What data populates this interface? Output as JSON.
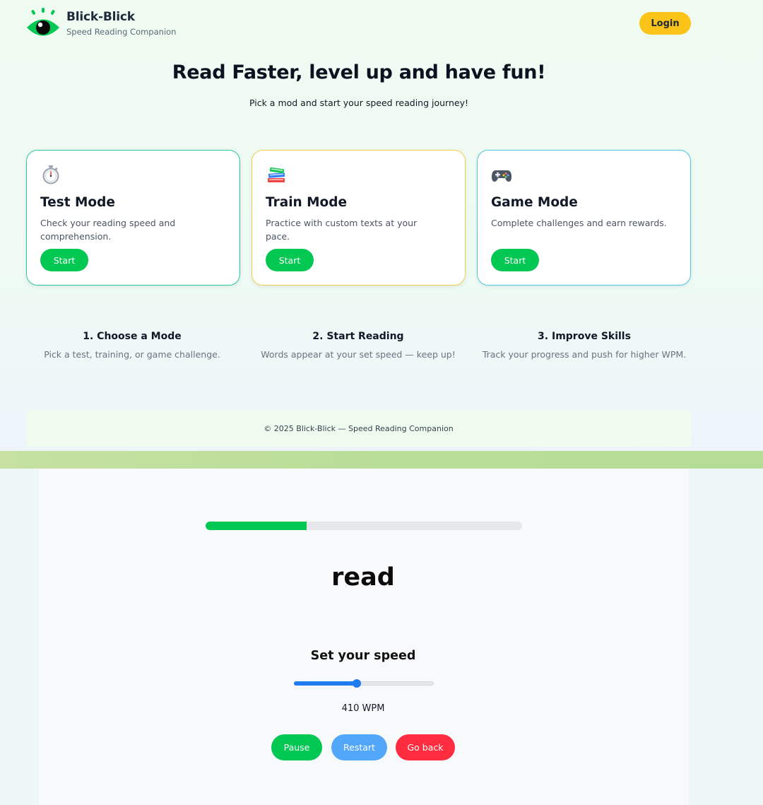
{
  "header": {
    "brand_name": "Blick-Blick",
    "brand_tagline": "Speed Reading Companion",
    "login_label": "Login"
  },
  "hero": {
    "title": "Read Faster, level up and have fun!",
    "subtitle": "Pick a mod and start your speed reading journey!"
  },
  "modes": [
    {
      "icon": "stopwatch-icon",
      "title": "Test Mode",
      "description": "Check your reading speed and comprehension.",
      "button": "Start",
      "border_color": "#2bc9a3"
    },
    {
      "icon": "books-icon",
      "title": "Train Mode",
      "description": "Practice with custom texts at your pace.",
      "button": "Start",
      "border_color": "#f2cf4a"
    },
    {
      "icon": "game-controller-icon",
      "title": "Game Mode",
      "description": "Complete challenges and earn rewards.",
      "button": "Start",
      "border_color": "#4cc6e0"
    }
  ],
  "steps": [
    {
      "title": "1. Choose a Mode",
      "description": "Pick a test, training, or game challenge."
    },
    {
      "title": "2. Start Reading",
      "description": "Words appear at your set speed — keep up!"
    },
    {
      "title": "3. Improve Skills",
      "description": "Track your progress and push for higher WPM."
    }
  ],
  "footer": {
    "text": "© 2025 Blick-Blick — Speed Reading Companion"
  },
  "reader": {
    "progress_percent": 32,
    "current_word": "read",
    "speed_title": "Set your speed",
    "speed_slider_fraction": 0.45,
    "wpm_label": "410 WPM",
    "buttons": {
      "pause": "Pause",
      "restart": "Restart",
      "go_back": "Go back"
    }
  },
  "colors": {
    "accent_green": "#00c853",
    "login_yellow": "#fcc419",
    "restart_blue": "#52a7fb",
    "go_back_red": "#ff2d3f",
    "slider_blue": "#1e7bf0"
  }
}
